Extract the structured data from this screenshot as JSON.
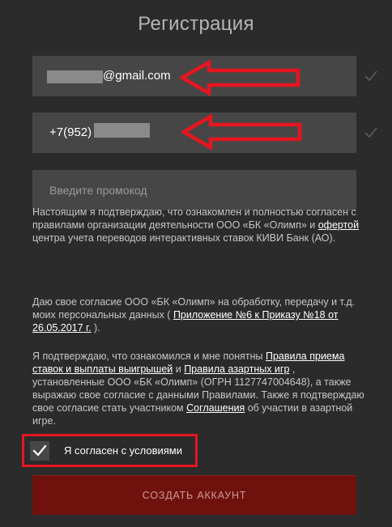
{
  "title": "Регистрация",
  "email_field": {
    "value_suffix": "@gmail.com"
  },
  "phone_field": {
    "value_prefix": "+7(952)"
  },
  "promo_field": {
    "placeholder": "Введите промокод",
    "value": ""
  },
  "terms": {
    "p1_a": "Настоящим я подтверждаю, что ознакомлен и полностью согласен с правилами организации деятельности ООО «БК «Олимп» и ",
    "p1_link": "офертой",
    "p1_b": " центра учета переводов интерактивных ставок КИВИ Банк (АО).",
    "p2_a": "Даю свое согласие ООО «БК «Олимп» на обработку, передачу и т.д. моих персональных данных ( ",
    "p2_link": "Приложение №6 к Приказу №18 от 26.05.2017 г.",
    "p2_b": " ).",
    "p3_a": "Я подтверждаю, что ознакомился и мне понятны ",
    "p3_link1": "Правила приема ставок и выплаты выигрышей",
    "p3_b": " и ",
    "p3_link2": "Правила азартных игр",
    "p3_c": " , установленные ООО «БК «Олимп» (ОГРН 1127747004648), а также выражаю свое согласие с данными Правилами. Также я подтверждаю свое согласие стать участником ",
    "p3_link3": "Соглашения",
    "p3_d": " об участии в азартной игре."
  },
  "consent": {
    "label": "Я согласен с условиями",
    "checked": true
  },
  "submit_label": "СОЗДАТЬ АККАУНТ",
  "colors": {
    "background": "#2b2b2b",
    "field": "#464646",
    "button": "#6f110d",
    "annotation_red": "#e5151f"
  },
  "icons": {
    "email_valid": "checkmark-icon",
    "phone_valid": "checkmark-icon",
    "consent_check": "checkmark-icon",
    "annotation": "arrow-left-icon"
  }
}
